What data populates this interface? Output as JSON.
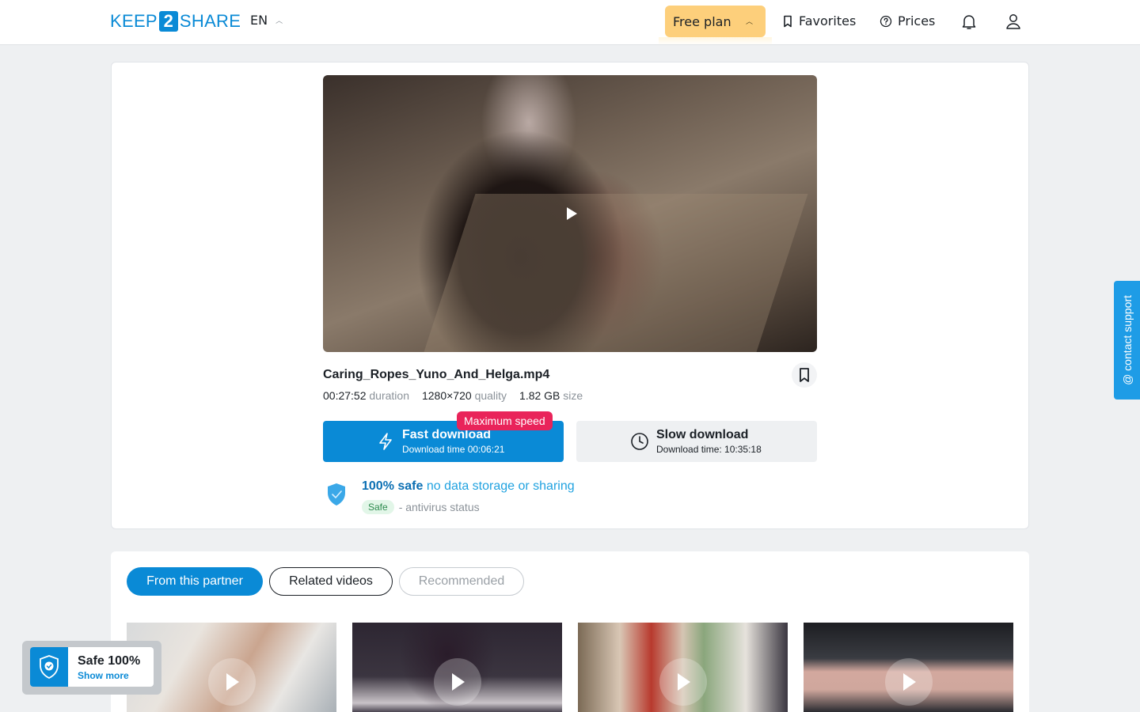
{
  "header": {
    "logo_left": "KEEP",
    "logo_mid": "2",
    "logo_right": "SHARE",
    "language": "EN",
    "free_plan_label": "Free plan",
    "favorites_label": "Favorites",
    "prices_label": "Prices",
    "accent_color": "#0a8ad6",
    "plan_color": "#fdcf7b"
  },
  "file": {
    "name": "Caring_Ropes_Yuno_And_Helga.mp4",
    "duration_value": "00:27:52",
    "duration_label": "duration",
    "quality_value": "1280×720",
    "quality_label": "quality",
    "size_value": "1.82 GB",
    "size_label": "size"
  },
  "download": {
    "max_speed_badge": "Maximum speed",
    "fast_title": "Fast download",
    "fast_time": "Download time 00:06:21",
    "slow_title": "Slow download",
    "slow_time": "Download time: 10:35:18",
    "badge_color": "#e9245a"
  },
  "safety": {
    "bold": "100% safe",
    "text": " no data storage or sharing",
    "badge": "Safe",
    "antivirus_text": "- antivirus status"
  },
  "tabs": [
    {
      "label": "From this partner"
    },
    {
      "label": "Related videos"
    },
    {
      "label": "Recommended"
    }
  ],
  "thumbnails_icon": "play-icon",
  "safe_widget": {
    "title": "Safe 100%",
    "link": "Show more"
  },
  "contact_support": "@ contact support"
}
